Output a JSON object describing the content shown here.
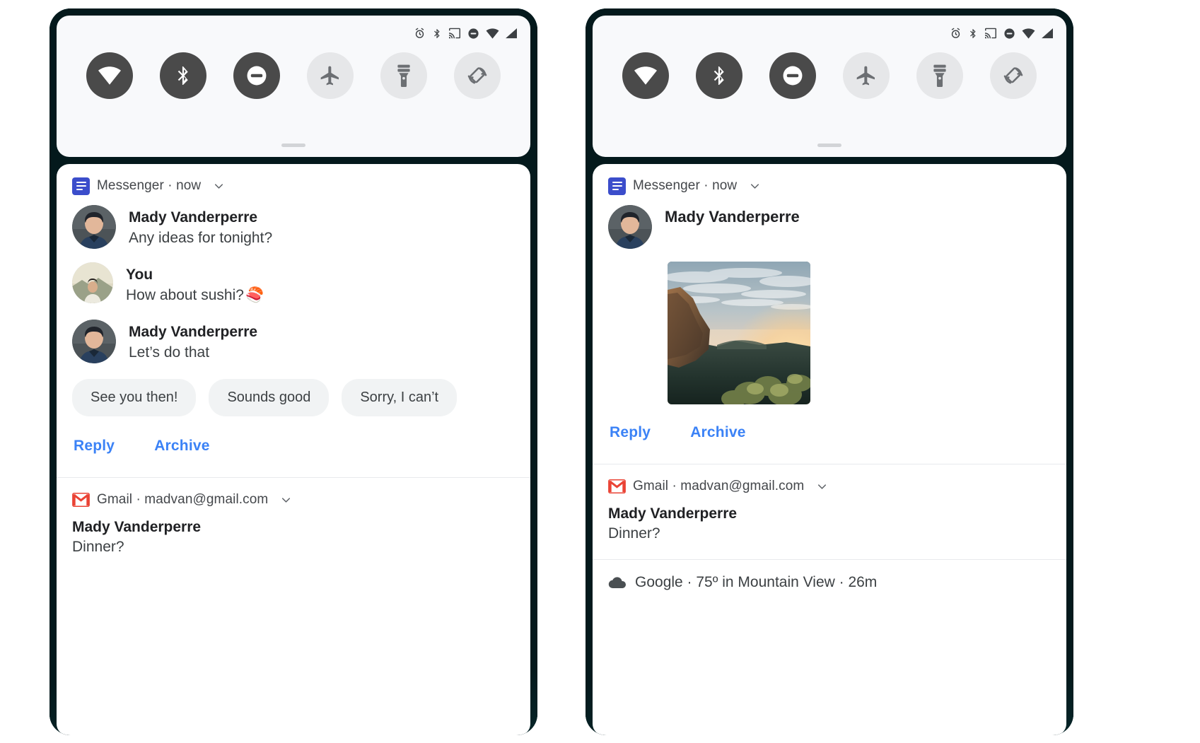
{
  "statusbar": {
    "icons": [
      "alarm-icon",
      "bluetooth-icon",
      "cast-icon",
      "do-not-disturb-icon",
      "wifi-icon",
      "signal-icon"
    ]
  },
  "quick_settings": {
    "tiles": [
      {
        "name": "wifi",
        "icon": "wifi-icon",
        "state": "on"
      },
      {
        "name": "bluetooth",
        "icon": "bluetooth-icon",
        "state": "on"
      },
      {
        "name": "dnd",
        "icon": "do-not-disturb-icon",
        "state": "on"
      },
      {
        "name": "airplane",
        "icon": "airplane-icon",
        "state": "off"
      },
      {
        "name": "flashlight",
        "icon": "flashlight-icon",
        "state": "off"
      },
      {
        "name": "autorotate",
        "icon": "auto-rotate-icon",
        "state": "off"
      }
    ],
    "handle": "drag-handle"
  },
  "colors": {
    "accent_link": "#3b82f6",
    "tile_on_bg": "#4a4a4a",
    "tile_off_bg": "#e6e7e9",
    "messenger_blue": "#3b4dcb",
    "gmail_red": "#ea4335",
    "card_bg": "#ffffff",
    "qs_bg": "#f8f9fb",
    "chip_bg": "#f1f3f4",
    "phone_frame": "#0b2a2c"
  },
  "left_panel": {
    "messenger": {
      "app_label": "Messenger · now",
      "app_icon": "messenger-icon",
      "expand_icon": "chevron-down-icon",
      "messages": [
        {
          "sender": "Mady Vanderperre",
          "text": "Any ideas for tonight?",
          "avatar": "avatar-mady"
        },
        {
          "sender": "You",
          "text": "How about sushi?",
          "emoji": "🍣",
          "avatar": "avatar-you"
        },
        {
          "sender": "Mady Vanderperre",
          "text": "Let’s do that",
          "avatar": "avatar-mady"
        }
      ],
      "smart_replies": [
        "See you then!",
        "Sounds good",
        "Sorry, I can’t"
      ],
      "actions": [
        "Reply",
        "Archive"
      ]
    },
    "gmail": {
      "app_label": "Gmail · madvan@gmail.com",
      "app_icon": "gmail-icon",
      "expand_icon": "chevron-down-icon",
      "title": "Mady Vanderperre",
      "text": "Dinner?"
    }
  },
  "right_panel": {
    "messenger": {
      "app_label": "Messenger · now",
      "app_icon": "messenger-icon",
      "expand_icon": "chevron-down-icon",
      "sender": "Mady Vanderperre",
      "attachment": "big-picture-sunset-cliff",
      "actions": [
        "Reply",
        "Archive"
      ]
    },
    "gmail": {
      "app_label": "Gmail · madvan@gmail.com",
      "app_icon": "gmail-icon",
      "expand_icon": "chevron-down-icon",
      "title": "Mady Vanderperre",
      "text": "Dinner?"
    },
    "weather": {
      "app_icon": "cloud-icon",
      "text": "Google · 75º in Mountain View · 26m"
    }
  }
}
